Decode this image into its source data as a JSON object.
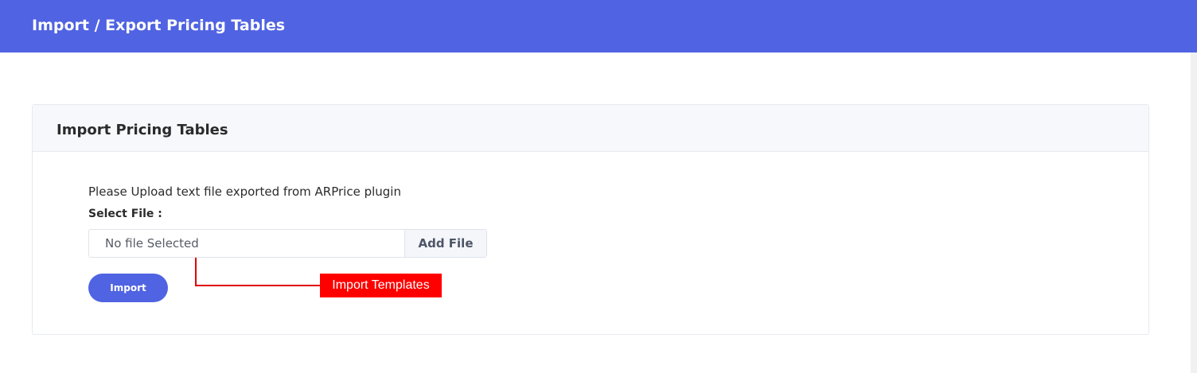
{
  "header": {
    "title": "Import / Export Pricing Tables"
  },
  "card": {
    "title": "Import Pricing Tables",
    "description": "Please Upload text file exported from ARPrice plugin",
    "select_label": "Select File :",
    "file_placeholder": "No file Selected",
    "add_file_label": "Add File",
    "import_label": "Import"
  },
  "annotation": {
    "label": "Import Templates"
  },
  "colors": {
    "accent": "#5063e2",
    "annotation": "#ff0000"
  }
}
